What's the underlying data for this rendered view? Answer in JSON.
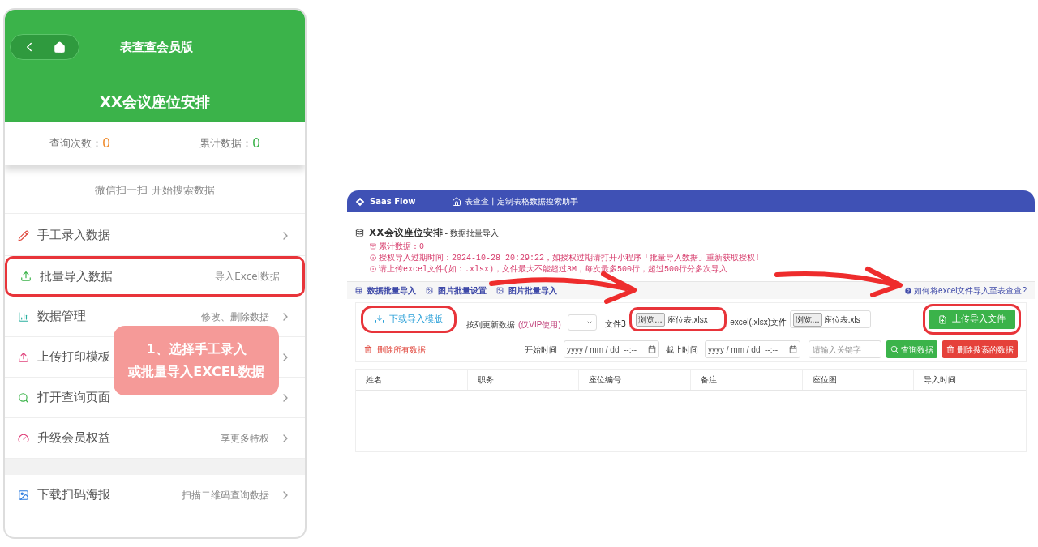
{
  "mobile": {
    "nav_title": "表查查会员版",
    "title": "XX会议座位安排",
    "stats": [
      {
        "label": "查询次数：",
        "value": "0",
        "color": "#f08c2e"
      },
      {
        "label": "累计数据：",
        "value": "0",
        "color": "#3bb34a"
      }
    ],
    "scan_hint": "微信扫一扫 开始搜索数据",
    "menu": [
      {
        "kind": "pencil",
        "title": "手工录入数据",
        "highlighted": false
      },
      {
        "kind": "upload",
        "title": "批量导入数据",
        "subtitle": "导入Excel数据",
        "highlighted": true
      },
      {
        "kind": "chart",
        "title": "数据管理",
        "subtitle": "修改、删除数据",
        "highlighted": false
      },
      {
        "kind": "print",
        "title": "上传打印模板",
        "highlighted": false
      },
      {
        "kind": "search",
        "title": "打开查询页面",
        "highlighted": false
      },
      {
        "kind": "upgrade",
        "title": "升级会员权益",
        "subtitle": "享更多特权",
        "highlighted": false
      },
      {
        "kind": "poster",
        "title": "下载扫码海报",
        "subtitle": "扫描二维码查询数据",
        "highlighted": false,
        "separated": true
      }
    ]
  },
  "caption": [
    "1、选择手工录入",
    "或批量导入EXCEL数据"
  ],
  "web": {
    "brand": "Saas Flow",
    "nav": "表查查丨定制表格数据搜索助手",
    "title": "XX会议座位安排",
    "subtitle": "- 数据批量导入",
    "notes": [
      {
        "kind": "count",
        "text": "累计数据：0"
      },
      {
        "kind": "alert",
        "text": "授权导入过期时间：2024-10-28 20:29:22，如授权过期请打开小程序「批量导入数据」重新获取授权!"
      },
      {
        "kind": "alert",
        "text": "请上传excel文件(如：.xlsx)，文件最大不能超过3M，每次最多500行，超过500行分多次导入"
      }
    ],
    "tabs": [
      {
        "label": "数据批量导入",
        "kind": "data"
      },
      {
        "label": "图片批量设置",
        "kind": "image"
      },
      {
        "label": "图片批量导入",
        "kind": "image"
      }
    ],
    "help_link": "如何将excel文件导入至表查查?",
    "download_button": {
      "label": "下载导入模版",
      "highlighted": true
    },
    "update_label": "按列更新数据",
    "vip_note": "(仅VIP使用)",
    "file_label": "文件3",
    "file_fields": [
      {
        "button": "浏览...",
        "value": "座位表.xlsx",
        "highlighted": true
      },
      {
        "button": "浏览...",
        "value": "座位表.xls",
        "highlighted": false
      }
    ],
    "file_label_2": "excel(.xlsx)文件",
    "upload_button": {
      "label": "上传导入文件",
      "highlighted": true
    },
    "delete_all": "删除所有数据",
    "start_label": "开始时间",
    "end_label": "截止时间",
    "start_placeholder": "yyyy / mm / dd  --:--",
    "end_placeholder": "yyyy / mm / dd  --:--",
    "keyword_placeholder": "请输入关键字",
    "search_button": "查询数据",
    "delete_search_button": "删除搜索的数据",
    "table": {
      "columns": [
        "姓名",
        "职务",
        "座位编号",
        "备注",
        "座位图",
        "导入时间"
      ]
    }
  }
}
